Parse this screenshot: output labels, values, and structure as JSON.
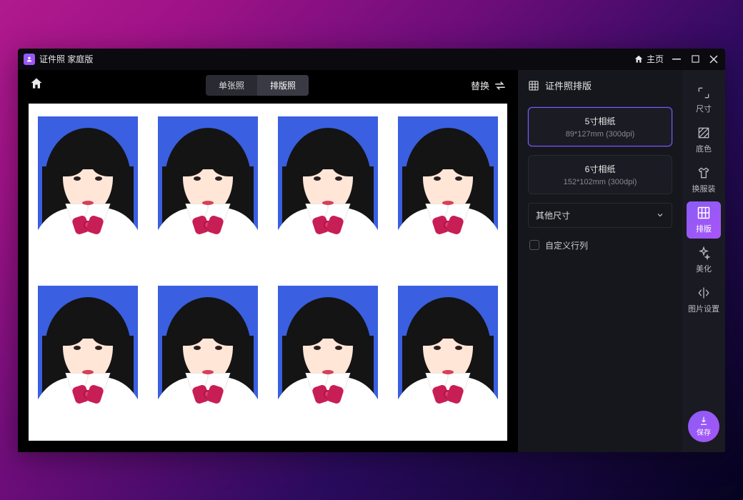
{
  "titlebar": {
    "app_name": "证件照 家庭版",
    "home_label": "主页"
  },
  "toolbar": {
    "tabs": {
      "single": "单张照",
      "layout": "排版照"
    },
    "replace_label": "替换"
  },
  "side_panel": {
    "title": "证件照排版",
    "sizes": [
      {
        "title": "5寸相纸",
        "detail": "89*127mm (300dpi)"
      },
      {
        "title": "6寸相纸",
        "detail": "152*102mm (300dpi)"
      }
    ],
    "other_sizes_label": "其他尺寸",
    "custom_rowcol_label": "自定义行列"
  },
  "rail": {
    "items": [
      {
        "label": "尺寸"
      },
      {
        "label": "底色"
      },
      {
        "label": "换服装"
      },
      {
        "label": "排版"
      },
      {
        "label": "美化"
      },
      {
        "label": "图片设置"
      }
    ],
    "save_label": "保存"
  },
  "canvas": {
    "photo_bg": "#3a5fe0",
    "rows": 2,
    "cols": 4
  }
}
